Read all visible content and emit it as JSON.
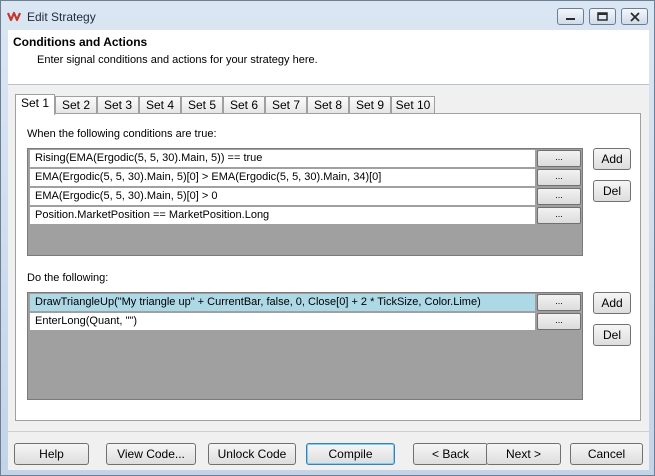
{
  "window": {
    "title": "Edit Strategy",
    "controls": [
      "minimize-icon",
      "maximize-icon",
      "close-icon"
    ]
  },
  "header": {
    "title": "Conditions and Actions",
    "subtitle": "Enter signal conditions and actions for your strategy here."
  },
  "tabs": [
    {
      "label": "Set 1",
      "active": true
    },
    {
      "label": "Set 2",
      "active": false
    },
    {
      "label": "Set 3",
      "active": false
    },
    {
      "label": "Set 4",
      "active": false
    },
    {
      "label": "Set 5",
      "active": false
    },
    {
      "label": "Set 6",
      "active": false
    },
    {
      "label": "Set 7",
      "active": false
    },
    {
      "label": "Set 8",
      "active": false
    },
    {
      "label": "Set 9",
      "active": false
    },
    {
      "label": "Set 10",
      "active": false
    }
  ],
  "conditions": {
    "label": "When the following conditions are true:",
    "rows": [
      "Rising(EMA(Ergodic(5, 5, 30).Main, 5)) == true",
      "EMA(Ergodic(5, 5, 30).Main, 5)[0] > EMA(Ergodic(5, 5, 30).Main, 34)[0]",
      "EMA(Ergodic(5, 5, 30).Main, 5)[0] > 0",
      "Position.MarketPosition == MarketPosition.Long"
    ],
    "row_button_label": "...",
    "add_label": "Add",
    "del_label": "Del"
  },
  "actions": {
    "label": "Do the following:",
    "rows": [
      "DrawTriangleUp(\"My triangle up\" + CurrentBar, false, 0, Close[0] + 2 * TickSize, Color.Lime)",
      "EnterLong(Quant, \"\")"
    ],
    "selected_row": 0,
    "row_button_label": "...",
    "add_label": "Add",
    "del_label": "Del"
  },
  "footer": {
    "help": "Help",
    "view_code": "View Code...",
    "unlock_code": "Unlock Code",
    "compile": "Compile",
    "back": "< Back",
    "next": "Next >",
    "cancel": "Cancel"
  },
  "colors": {
    "selected_row": "#add8e6",
    "grid_background": "#a0a0a0",
    "app_icon": "#c0392b"
  }
}
